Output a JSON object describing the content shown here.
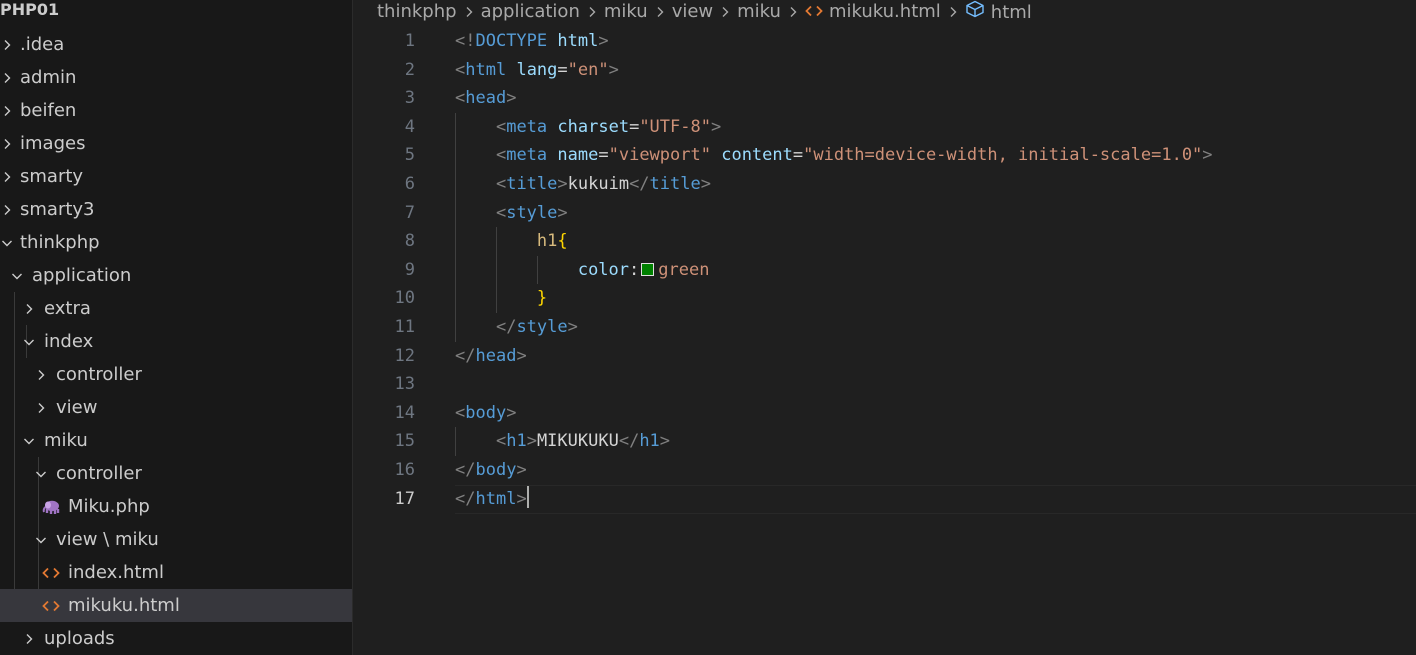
{
  "explorer": {
    "root": "PHP01",
    "items": [
      {
        "label": ".idea",
        "expanded": false,
        "kind": "folder"
      },
      {
        "label": "admin",
        "expanded": false,
        "kind": "folder"
      },
      {
        "label": "beifen",
        "expanded": false,
        "kind": "folder"
      },
      {
        "label": "images",
        "expanded": false,
        "kind": "folder"
      },
      {
        "label": "smarty",
        "expanded": false,
        "kind": "folder"
      },
      {
        "label": "smarty3",
        "expanded": false,
        "kind": "folder"
      },
      {
        "label": "thinkphp",
        "expanded": true,
        "kind": "folder"
      },
      {
        "label": "application",
        "expanded": true,
        "kind": "folder"
      },
      {
        "label": "extra",
        "expanded": false,
        "kind": "folder"
      },
      {
        "label": "index",
        "expanded": true,
        "kind": "folder"
      },
      {
        "label": "controller",
        "expanded": false,
        "kind": "folder"
      },
      {
        "label": "view",
        "expanded": false,
        "kind": "folder"
      },
      {
        "label": "miku",
        "expanded": true,
        "kind": "folder"
      },
      {
        "label": "controller",
        "expanded": true,
        "kind": "folder"
      },
      {
        "label": "Miku.php",
        "kind": "php-file"
      },
      {
        "label": "view \\ miku",
        "expanded": true,
        "kind": "folder"
      },
      {
        "label": "index.html",
        "kind": "html-file"
      },
      {
        "label": "mikuku.html",
        "kind": "html-file",
        "selected": true
      },
      {
        "label": "uploads",
        "expanded": false,
        "kind": "folder"
      }
    ]
  },
  "breadcrumb": {
    "parts": [
      "thinkphp",
      "application",
      "miku",
      "view",
      "miku"
    ],
    "file": "mikuku.html",
    "symbol": "html"
  },
  "editor": {
    "active_line": 17,
    "lines": [
      {
        "num": "1",
        "tokens": [
          {
            "t": "<!",
            "c": "punc"
          },
          {
            "t": "DOCTYPE",
            "c": "tag"
          },
          {
            "t": " ",
            "c": "text"
          },
          {
            "t": "html",
            "c": "attr"
          },
          {
            "t": ">",
            "c": "punc"
          }
        ]
      },
      {
        "num": "2",
        "tokens": [
          {
            "t": "<",
            "c": "punc"
          },
          {
            "t": "html",
            "c": "tag"
          },
          {
            "t": " ",
            "c": "text"
          },
          {
            "t": "lang",
            "c": "attr"
          },
          {
            "t": "=",
            "c": "text"
          },
          {
            "t": "\"en\"",
            "c": "str"
          },
          {
            "t": ">",
            "c": "punc"
          }
        ]
      },
      {
        "num": "3",
        "tokens": [
          {
            "t": "<",
            "c": "punc"
          },
          {
            "t": "head",
            "c": "tag"
          },
          {
            "t": ">",
            "c": "punc"
          }
        ]
      },
      {
        "num": "4",
        "tokens": [
          {
            "t": "    ",
            "c": "text"
          },
          {
            "t": "<",
            "c": "punc"
          },
          {
            "t": "meta",
            "c": "tag"
          },
          {
            "t": " ",
            "c": "text"
          },
          {
            "t": "charset",
            "c": "attr"
          },
          {
            "t": "=",
            "c": "text"
          },
          {
            "t": "\"UTF-8\"",
            "c": "str"
          },
          {
            "t": ">",
            "c": "punc"
          }
        ]
      },
      {
        "num": "5",
        "tokens": [
          {
            "t": "    ",
            "c": "text"
          },
          {
            "t": "<",
            "c": "punc"
          },
          {
            "t": "meta",
            "c": "tag"
          },
          {
            "t": " ",
            "c": "text"
          },
          {
            "t": "name",
            "c": "attr"
          },
          {
            "t": "=",
            "c": "text"
          },
          {
            "t": "\"viewport\"",
            "c": "str"
          },
          {
            "t": " ",
            "c": "text"
          },
          {
            "t": "content",
            "c": "attr"
          },
          {
            "t": "=",
            "c": "text"
          },
          {
            "t": "\"width=device-width, initial-scale=1.0\"",
            "c": "str"
          },
          {
            "t": ">",
            "c": "punc"
          }
        ]
      },
      {
        "num": "6",
        "tokens": [
          {
            "t": "    ",
            "c": "text"
          },
          {
            "t": "<",
            "c": "punc"
          },
          {
            "t": "title",
            "c": "tag"
          },
          {
            "t": ">",
            "c": "punc"
          },
          {
            "t": "kukuim",
            "c": "text"
          },
          {
            "t": "</",
            "c": "punc"
          },
          {
            "t": "title",
            "c": "tag"
          },
          {
            "t": ">",
            "c": "punc"
          }
        ]
      },
      {
        "num": "7",
        "tokens": [
          {
            "t": "    ",
            "c": "text"
          },
          {
            "t": "<",
            "c": "punc"
          },
          {
            "t": "style",
            "c": "tag"
          },
          {
            "t": ">",
            "c": "punc"
          }
        ]
      },
      {
        "num": "8",
        "tokens": [
          {
            "t": "        ",
            "c": "text"
          },
          {
            "t": "h1",
            "c": "sel"
          },
          {
            "t": "{",
            "c": "brace"
          }
        ]
      },
      {
        "num": "9",
        "tokens": [
          {
            "t": "            ",
            "c": "text"
          },
          {
            "t": "color",
            "c": "prop"
          },
          {
            "t": ":",
            "c": "text"
          },
          {
            "swatch": "#008000"
          },
          {
            "t": "green",
            "c": "val"
          }
        ]
      },
      {
        "num": "10",
        "tokens": [
          {
            "t": "        ",
            "c": "text"
          },
          {
            "t": "}",
            "c": "brace"
          }
        ]
      },
      {
        "num": "11",
        "tokens": [
          {
            "t": "    ",
            "c": "text"
          },
          {
            "t": "</",
            "c": "punc"
          },
          {
            "t": "style",
            "c": "tag"
          },
          {
            "t": ">",
            "c": "punc"
          }
        ]
      },
      {
        "num": "12",
        "tokens": [
          {
            "t": "</",
            "c": "punc"
          },
          {
            "t": "head",
            "c": "tag"
          },
          {
            "t": ">",
            "c": "punc"
          }
        ]
      },
      {
        "num": "13",
        "tokens": []
      },
      {
        "num": "14",
        "tokens": [
          {
            "t": "<",
            "c": "punc"
          },
          {
            "t": "body",
            "c": "tag"
          },
          {
            "t": ">",
            "c": "punc"
          }
        ]
      },
      {
        "num": "15",
        "tokens": [
          {
            "t": "    ",
            "c": "text"
          },
          {
            "t": "<",
            "c": "punc"
          },
          {
            "t": "h1",
            "c": "tag"
          },
          {
            "t": ">",
            "c": "punc"
          },
          {
            "t": "MIKUKUKU",
            "c": "text"
          },
          {
            "t": "</",
            "c": "punc"
          },
          {
            "t": "h1",
            "c": "tag"
          },
          {
            "t": ">",
            "c": "punc"
          }
        ]
      },
      {
        "num": "16",
        "tokens": [
          {
            "t": "</",
            "c": "punc"
          },
          {
            "t": "body",
            "c": "tag"
          },
          {
            "t": ">",
            "c": "punc"
          }
        ]
      },
      {
        "num": "17",
        "tokens": [
          {
            "t": "</",
            "c": "punc"
          },
          {
            "t": "html",
            "c": "tag"
          },
          {
            "t": ">",
            "c": "punc"
          },
          {
            "cursor": true
          }
        ]
      }
    ]
  },
  "colors": {
    "sidebar_bg": "#181818",
    "editor_bg": "#1f1f1f",
    "selected_row": "#37373d",
    "html_icon": "#e37933",
    "php_icon": "#a074c4",
    "symbol_icon": "#75beff"
  }
}
